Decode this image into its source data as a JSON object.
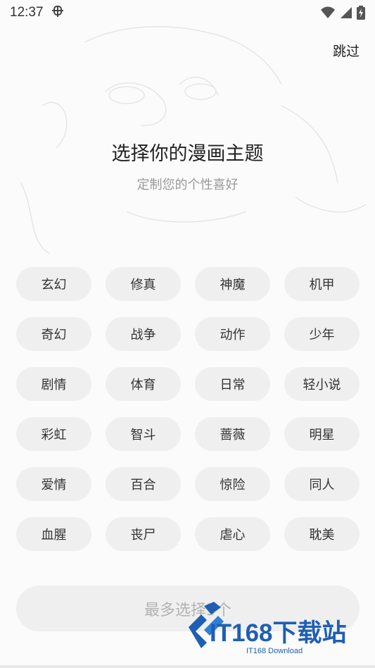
{
  "status_bar": {
    "time": "12:37",
    "app_icon": "bug-icon",
    "icons": [
      "wifi-icon",
      "signal-icon",
      "battery-charging-icon"
    ]
  },
  "header": {
    "skip_label": "跳过"
  },
  "intro": {
    "title": "选择你的漫画主题",
    "subtitle": "定制您的个性喜好"
  },
  "themes": [
    "玄幻",
    "修真",
    "神魔",
    "机甲",
    "奇幻",
    "战争",
    "动作",
    "少年",
    "剧情",
    "体育",
    "日常",
    "轻小说",
    "彩虹",
    "智斗",
    "蔷薇",
    "明星",
    "爱情",
    "百合",
    "惊险",
    "同人",
    "血腥",
    "丧尸",
    "虐心",
    "耽美"
  ],
  "confirm": {
    "label": "最多选择5个"
  },
  "watermark": {
    "text": "IT168下载站",
    "sub": "IT168 Download"
  },
  "colors": {
    "tag_bg": "#efefef",
    "brand_blue": "#1e5fb4"
  }
}
